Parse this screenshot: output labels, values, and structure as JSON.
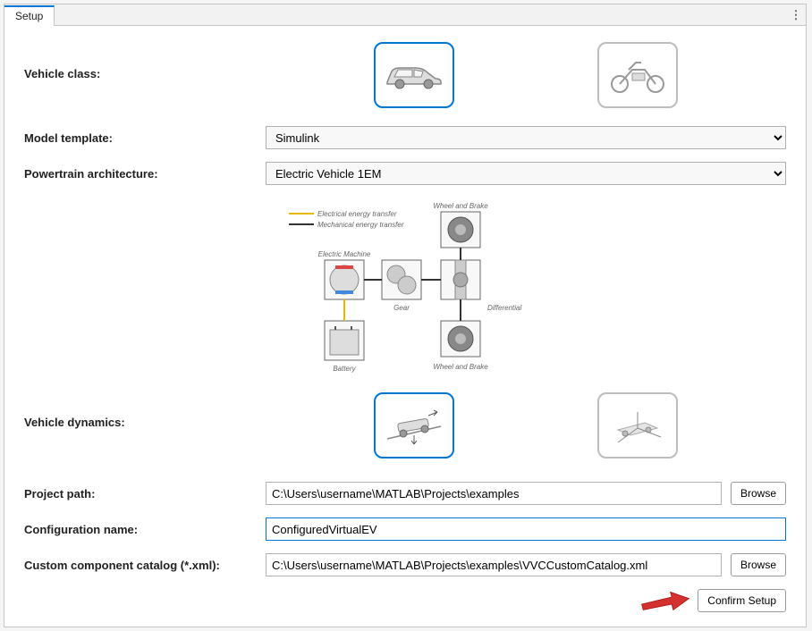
{
  "tab": {
    "label": "Setup"
  },
  "fields": {
    "vehicle_class_label": "Vehicle class:",
    "model_template_label": "Model template:",
    "model_template_value": "Simulink",
    "powertrain_label": "Powertrain architecture:",
    "powertrain_value": "Electric Vehicle 1EM",
    "vehicle_dynamics_label": "Vehicle dynamics:",
    "project_path_label": "Project path:",
    "project_path_value": "C:\\Users\\username\\MATLAB\\Projects\\examples",
    "config_name_label": "Configuration name:",
    "config_name_value": "ConfiguredVirtualEV",
    "catalog_label": "Custom component catalog (*.xml):",
    "catalog_value": "C:\\Users\\username\\MATLAB\\Projects\\examples\\VVCCustomCatalog.xml"
  },
  "diagram": {
    "legend_elec": "Electrical energy transfer",
    "legend_mech": "Mechanical energy transfer",
    "wheel_brake": "Wheel and Brake",
    "electric_machine": "Electric Machine",
    "gear": "Gear",
    "differential": "Differential",
    "battery": "Battery"
  },
  "buttons": {
    "browse": "Browse",
    "confirm": "Confirm Setup"
  }
}
